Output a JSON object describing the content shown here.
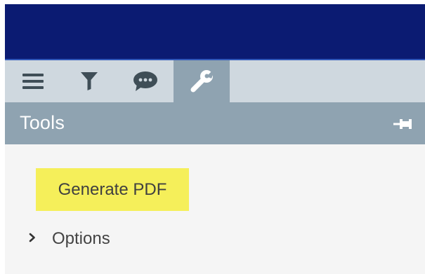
{
  "colors": {
    "header_bg": "#0b1b72",
    "toolbar_bg": "#cfd8df",
    "active_tab_bg": "#8fa3b1",
    "panel_header_bg": "#8fa3b1",
    "icon_color": "#3f4e57",
    "highlight": "#f5ef5a"
  },
  "toolbar": {
    "tabs": [
      {
        "icon": "menu-icon",
        "active": false
      },
      {
        "icon": "filter-icon",
        "active": false
      },
      {
        "icon": "comment-icon",
        "active": false
      },
      {
        "icon": "wrench-icon",
        "active": true
      }
    ]
  },
  "panel": {
    "title": "Tools",
    "pin_icon": "pin-icon"
  },
  "tools": {
    "generate_pdf_label": "Generate PDF",
    "options_label": "Options",
    "options_icon": "chevron-right-icon"
  }
}
